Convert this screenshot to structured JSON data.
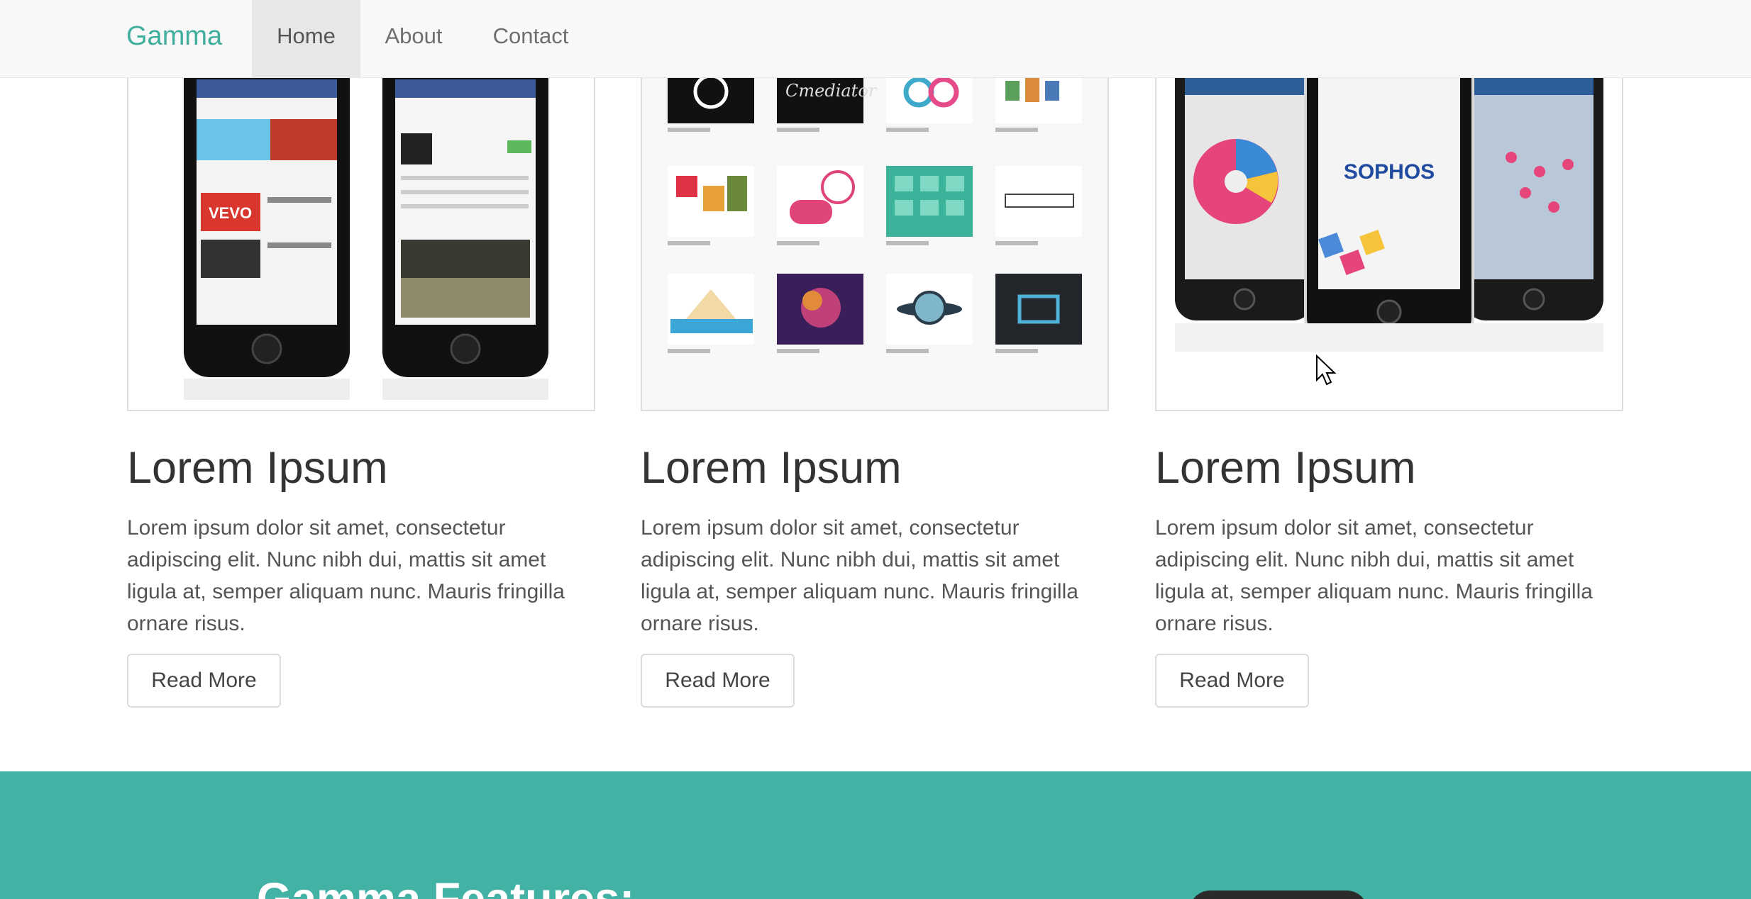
{
  "navbar": {
    "brand": "Gamma",
    "links": [
      {
        "label": "Home",
        "active": true
      },
      {
        "label": "About",
        "active": false
      },
      {
        "label": "Contact",
        "active": false
      }
    ]
  },
  "cards": [
    {
      "image": "app-store-phones-screenshot",
      "title": "Lorem Ipsum",
      "text": "Lorem ipsum dolor sit amet, consectetur adipiscing elit. Nunc nibh dui, mattis sit amet ligula at, semper aliquam nunc. Mauris fringilla ornare risus.",
      "button": "Read More"
    },
    {
      "image": "design-gallery-grid-screenshot",
      "title": "Lorem Ipsum",
      "text": "Lorem ipsum dolor sit amet, consectetur adipiscing elit. Nunc nibh dui, mattis sit amet ligula at, semper aliquam nunc. Mauris fringilla ornare risus.",
      "button": "Read More"
    },
    {
      "image": "sophos-phones-screenshot",
      "title": "Lorem Ipsum",
      "text": "Lorem ipsum dolor sit amet, consectetur adipiscing elit. Nunc nibh dui, mattis sit amet ligula at, semper aliquam nunc. Mauris fringilla ornare risus.",
      "button": "Read More",
      "image_text": "SOPHOS"
    }
  ],
  "features": {
    "title": "Gamma Features:"
  },
  "colors": {
    "brand": "#3fae9c",
    "features_band": "#41b2a3",
    "navbar_bg": "#f8f8f8",
    "active_tab_bg": "#e7e7e7"
  }
}
